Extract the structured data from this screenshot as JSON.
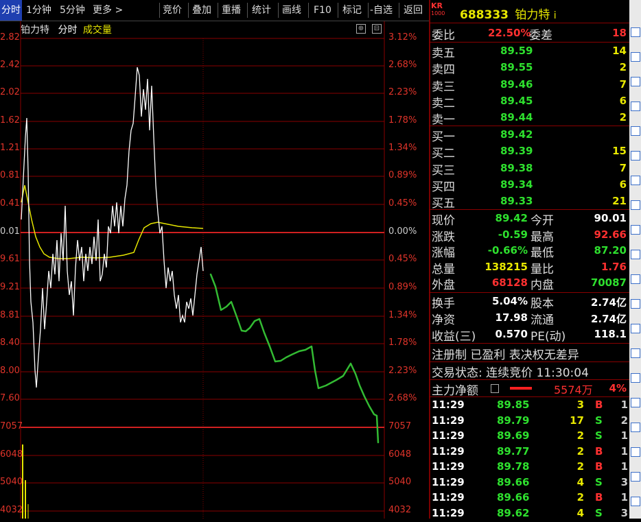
{
  "toolbar": {
    "tabs": [
      "分时",
      "1分钟",
      "5分钟",
      "更多 >"
    ],
    "buttons": [
      "竞价",
      "叠加",
      "重播",
      "统计",
      "画线",
      "F10",
      "标记",
      "-自选",
      "返回"
    ]
  },
  "chart": {
    "name": "铂力特",
    "mode": "分时",
    "indicator": "成交量",
    "left_axis": [
      "2.82",
      "2.42",
      "2.02",
      "1.62",
      "1.21",
      "0.81",
      "0.41",
      "0.01",
      "9.61",
      "9.21",
      "8.81",
      "8.40",
      "8.00",
      "7.60",
      "7057",
      "6048",
      "5040",
      "4032"
    ],
    "right_axis": [
      "3.12%",
      "2.68%",
      "2.23%",
      "1.78%",
      "1.34%",
      "0.89%",
      "0.45%",
      "0.00%",
      "0.45%",
      "0.89%",
      "1.34%",
      "1.78%",
      "2.23%",
      "2.68%",
      "7057",
      "6048",
      "5040",
      "4032"
    ],
    "colors": {
      "price": "#ffffff",
      "avg": "#e6e600",
      "annotation": "#33bb33",
      "grid": "#8a0000"
    }
  },
  "quote": {
    "badge_top": "KR",
    "badge_bottom": "1000",
    "code": "688333",
    "name": "铂力特",
    "name_suffix": "i",
    "weibi_label": "委比",
    "weibi": "22.50%",
    "weicha_label": "委差",
    "weicha": "18",
    "asks": [
      {
        "label": "卖五",
        "price": "89.59",
        "qty": "14"
      },
      {
        "label": "卖四",
        "price": "89.55",
        "qty": "2"
      },
      {
        "label": "卖三",
        "price": "89.46",
        "qty": "7"
      },
      {
        "label": "卖二",
        "price": "89.45",
        "qty": "6"
      },
      {
        "label": "卖一",
        "price": "89.44",
        "qty": "2"
      }
    ],
    "bids": [
      {
        "label": "买一",
        "price": "89.42",
        "qty": ""
      },
      {
        "label": "买二",
        "price": "89.39",
        "qty": "15"
      },
      {
        "label": "买三",
        "price": "89.38",
        "qty": "7"
      },
      {
        "label": "买四",
        "price": "89.34",
        "qty": "6"
      },
      {
        "label": "买五",
        "price": "89.33",
        "qty": "21"
      }
    ],
    "stats": [
      {
        "l1": "现价",
        "v1": "89.42",
        "c1": "#2ee02e",
        "l2": "今开",
        "v2": "90.01",
        "c2": "#ffffff"
      },
      {
        "l1": "涨跌",
        "v1": "-0.59",
        "c1": "#2ee02e",
        "l2": "最高",
        "v2": "92.66",
        "c2": "#ff3030"
      },
      {
        "l1": "涨幅",
        "v1": "-0.66%",
        "c1": "#2ee02e",
        "l2": "最低",
        "v2": "87.20",
        "c2": "#2ee02e"
      },
      {
        "l1": "总量",
        "v1": "138215",
        "c1": "#e8e800",
        "l2": "量比",
        "v2": "1.76",
        "c2": "#ff3030"
      },
      {
        "l1": "外盘",
        "v1": "68128",
        "c1": "#ff3030",
        "l2": "内盘",
        "v2": "70087",
        "c2": "#2ee02e"
      }
    ],
    "stats2": [
      {
        "l1": "换手",
        "v1": "5.04%",
        "l2": "股本",
        "v2": "2.74亿"
      },
      {
        "l1": "净资",
        "v1": "17.98",
        "l2": "流通",
        "v2": "2.74亿"
      },
      {
        "l1": "收益(三)",
        "v1": "0.570",
        "l2": "PE(动)",
        "v2": "118.1"
      }
    ],
    "tags": "注册制 已盈利 表决权无差异",
    "trade_status": "交易状态: 连续竞价 11:30:04",
    "main_flow_label": "主力净额",
    "main_flow_value": "5574万",
    "main_flow_pct": "4%"
  },
  "ticks": [
    {
      "time": "11:29",
      "price": "89.85",
      "vol": "3",
      "side": "B",
      "n": "1"
    },
    {
      "time": "11:29",
      "price": "89.79",
      "vol": "17",
      "side": "S",
      "n": "2"
    },
    {
      "time": "11:29",
      "price": "89.69",
      "vol": "2",
      "side": "S",
      "n": "1"
    },
    {
      "time": "11:29",
      "price": "89.77",
      "vol": "2",
      "side": "B",
      "n": "1"
    },
    {
      "time": "11:29",
      "price": "89.78",
      "vol": "2",
      "side": "B",
      "n": "1"
    },
    {
      "time": "11:29",
      "price": "89.66",
      "vol": "4",
      "side": "S",
      "n": "3"
    },
    {
      "time": "11:29",
      "price": "89.66",
      "vol": "2",
      "side": "B",
      "n": "1"
    },
    {
      "time": "11:29",
      "price": "89.62",
      "vol": "4",
      "side": "S",
      "n": "3"
    }
  ]
}
